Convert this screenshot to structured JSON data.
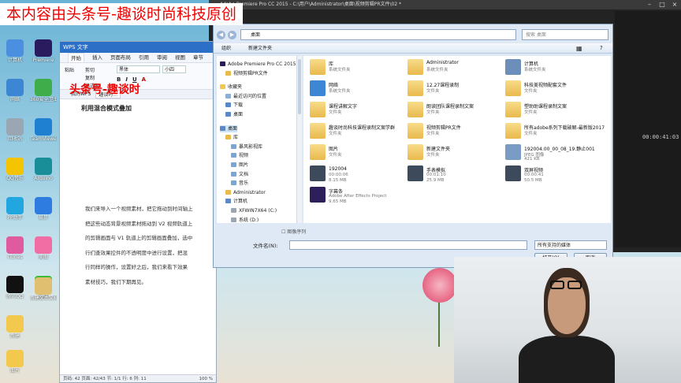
{
  "watermark": "本内容由头条号-趣谈时尚科技原创",
  "desktop_icons": [
    {
      "label": "计算机",
      "color": "#4a8fe0"
    },
    {
      "label": "网络",
      "color": "#3c86d3"
    },
    {
      "label": "回收站",
      "color": "#9aa7b3"
    },
    {
      "label": "QQ音乐",
      "color": "#f5c400"
    },
    {
      "label": "PP助手",
      "color": "#22a6e0"
    },
    {
      "label": "iTunes",
      "color": "#e05aa0"
    },
    {
      "label": "腾讯QQ",
      "color": "#111111"
    },
    {
      "label": "Premiere",
      "color": "#2a1a5e"
    },
    {
      "label": "360安全卫士",
      "color": "#3fae4a"
    },
    {
      "label": "TeamViewer",
      "color": "#1f7fd1"
    },
    {
      "label": "Arduino",
      "color": "#1a8e98"
    },
    {
      "label": "易贝",
      "color": "#2f7ce0"
    },
    {
      "label": "美图",
      "color": "#f06ea4"
    },
    {
      "label": "微信",
      "color": "#3cba3c"
    },
    {
      "label": "新建文本文档",
      "color": "#e0c070"
    },
    {
      "label": "新建",
      "color": "#f2c94c"
    },
    {
      "label": "图片",
      "color": "#f2c94c"
    }
  ],
  "wps": {
    "app_label": "WPS 文字",
    "menu": [
      "开始",
      "插入",
      "页面布局",
      "引用",
      "审阅",
      "视图",
      "章节"
    ],
    "font": "黑体",
    "size": "小四",
    "tabs": [
      "我的WPS",
      "趣谈时..."
    ],
    "doc_title": "头条号-趣谈时",
    "doc_subtitle": "利用混合模式叠加",
    "lines": [
      "我们来导入一个视频素材，把它拖动到时间轴上",
      "把这些动态背景视频素材拖动到 V2 视频轨道上",
      "的剪辑画面与 V1 轨道上的剪辑画面叠加，选中",
      "行们查效果控件的不透明度中进行设置，把混",
      "行同样的操作，设置好之后，我们来看下效果",
      "素材技巧，我们下期再见。"
    ],
    "status": "页码: 42   页面: 42/43   节: 1/1   行: 6   列: 11",
    "zoom": "100 %"
  },
  "premiere": {
    "title": "Adobe Premiere Pro CC 2015 - C:\\用户\\Administrator\\桌面\\视频剪辑PR文件\\02 *",
    "timecode": "00:00:41:03"
  },
  "dialog": {
    "path": "桌面",
    "search_placeholder": "搜索 桌面",
    "toolbar": [
      "组织",
      "新建文件夹"
    ],
    "tree": [
      {
        "label": "Adobe Premiere Pro CC 2015",
        "depth": 0,
        "color": "#2a1a5e"
      },
      {
        "label": "视频剪辑PR文件",
        "depth": 1,
        "color": "#e9b94c"
      },
      {
        "label": "收藏夹",
        "depth": 0,
        "color": "#f2c94c"
      },
      {
        "label": "最近访问的位置",
        "depth": 1,
        "color": "#8ab0d8"
      },
      {
        "label": "下载",
        "depth": 1,
        "color": "#5a87c8"
      },
      {
        "label": "桌面",
        "depth": 1,
        "color": "#5a87c8"
      },
      {
        "label": "桌面",
        "depth": 0,
        "color": "#5a87c8",
        "selected": true
      },
      {
        "label": "库",
        "depth": 1,
        "color": "#e9b94c"
      },
      {
        "label": "暴风影视库",
        "depth": 2,
        "color": "#7aa6d6"
      },
      {
        "label": "视频",
        "depth": 2,
        "color": "#7aa6d6"
      },
      {
        "label": "图片",
        "depth": 2,
        "color": "#7aa6d6"
      },
      {
        "label": "文档",
        "depth": 2,
        "color": "#7aa6d6"
      },
      {
        "label": "音乐",
        "depth": 2,
        "color": "#7aa6d6"
      },
      {
        "label": "Administrator",
        "depth": 1,
        "color": "#e9b94c"
      },
      {
        "label": "计算机",
        "depth": 1,
        "color": "#5a87c8"
      },
      {
        "label": "XFWIN7X64 (C:)",
        "depth": 2,
        "color": "#9aa7b3"
      },
      {
        "label": "系统 (D:)",
        "depth": 2,
        "color": "#9aa7b3"
      }
    ],
    "files": [
      {
        "name": "库",
        "desc": "系统文件夹",
        "desc2": "",
        "kind": "folder"
      },
      {
        "name": "Administrator",
        "desc": "系统文件夹",
        "desc2": "",
        "kind": "folder"
      },
      {
        "name": "计算机",
        "desc": "系统文件夹",
        "desc2": "",
        "kind": "computer"
      },
      {
        "name": "网络",
        "desc": "系统文件夹",
        "desc2": "",
        "kind": "network"
      },
      {
        "name": "12.27课程录制",
        "desc": "文件夹",
        "desc2": "",
        "kind": "folder"
      },
      {
        "name": "科技美视频配套文件",
        "desc": "文件夹",
        "desc2": "",
        "kind": "folder"
      },
      {
        "name": "课程讲解文字",
        "desc": "文件夹",
        "desc2": "",
        "kind": "folder"
      },
      {
        "name": "朗读团队课程录制文案",
        "desc": "文件夹",
        "desc2": "",
        "kind": "folder"
      },
      {
        "name": "塑助助课程录制文案",
        "desc": "文件夹",
        "desc2": "",
        "kind": "folder"
      },
      {
        "name": "趣谈时尚科技课程录制文案学群",
        "desc": "文件夹",
        "desc2": "",
        "kind": "folder"
      },
      {
        "name": "视频剪辑PR文件",
        "desc": "文件夹",
        "desc2": "",
        "kind": "folder"
      },
      {
        "name": "所有adobe系列下载破解-最新版2017",
        "desc": "文件夹",
        "desc2": "",
        "kind": "folder"
      },
      {
        "name": "图片",
        "desc": "文件夹",
        "desc2": "",
        "kind": "folder"
      },
      {
        "name": "新建文件夹",
        "desc": "文件夹",
        "desc2": "",
        "kind": "folder"
      },
      {
        "name": "192004.00_00_08_19.静止001",
        "desc": "JPEG 图像",
        "desc2": "421 KB",
        "kind": "image"
      },
      {
        "name": "192004",
        "desc": "00:00:06",
        "desc2": "8.15 MB",
        "kind": "video"
      },
      {
        "name": "手表模拟",
        "desc": "00:01:10",
        "desc2": "25.9 MB",
        "kind": "video"
      },
      {
        "name": "双屏视频",
        "desc": "00:00:41",
        "desc2": "50.5 MB",
        "kind": "video"
      },
      {
        "name": "字幕条",
        "desc": "Adobe After Effects Project",
        "desc2": "9.65 MB",
        "kind": "ae"
      }
    ],
    "preview_label": "图像序列",
    "filename_label": "文件名(N):",
    "filetype": "所有支持的媒体",
    "open_button": "打开(O)",
    "cancel_button": "取消"
  }
}
